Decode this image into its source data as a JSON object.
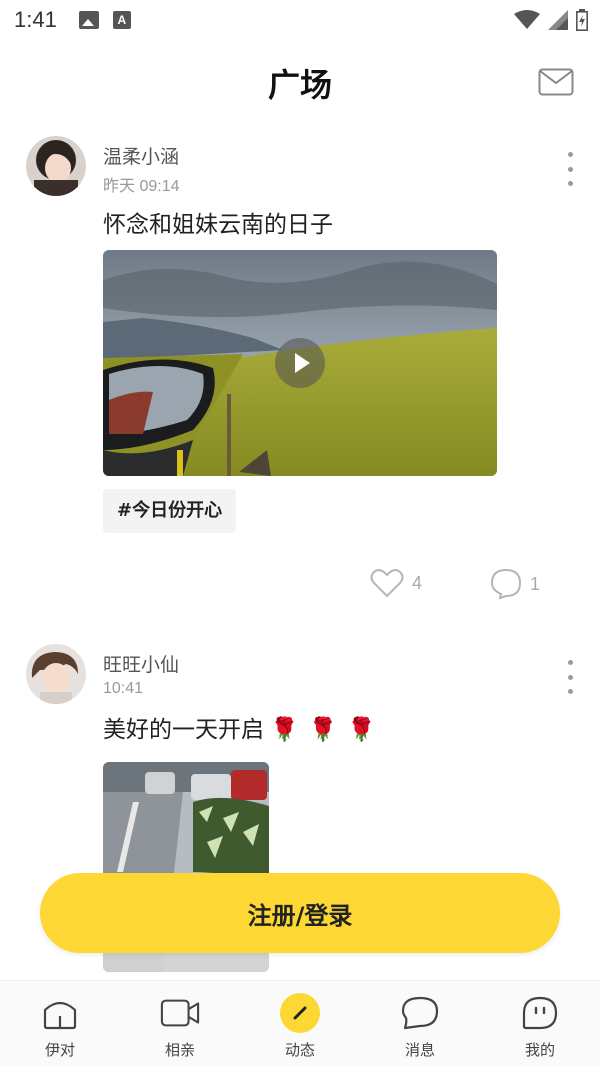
{
  "status_bar": {
    "time": "1:41"
  },
  "header": {
    "title": "广场"
  },
  "posts": [
    {
      "username": "温柔小涵",
      "time": "昨天 09:14",
      "text": "怀念和姐妹云南的日子",
      "tag": "#今日份开心",
      "likes": "4",
      "comments": "1"
    },
    {
      "username": "旺旺小仙",
      "time": "10:41",
      "text": "美好的一天开启",
      "emoji": "🌹🌹🌹"
    }
  ],
  "login_button": "注册/登录",
  "tabs": [
    {
      "label": "伊对",
      "icon": "home-icon"
    },
    {
      "label": "相亲",
      "icon": "video-camera-icon"
    },
    {
      "label": "动态",
      "icon": "pen-icon"
    },
    {
      "label": "消息",
      "icon": "chat-bubble-icon"
    },
    {
      "label": "我的",
      "icon": "face-icon"
    }
  ],
  "colors": {
    "accent": "#fdd835",
    "text": "#222222",
    "muted": "#999999"
  }
}
